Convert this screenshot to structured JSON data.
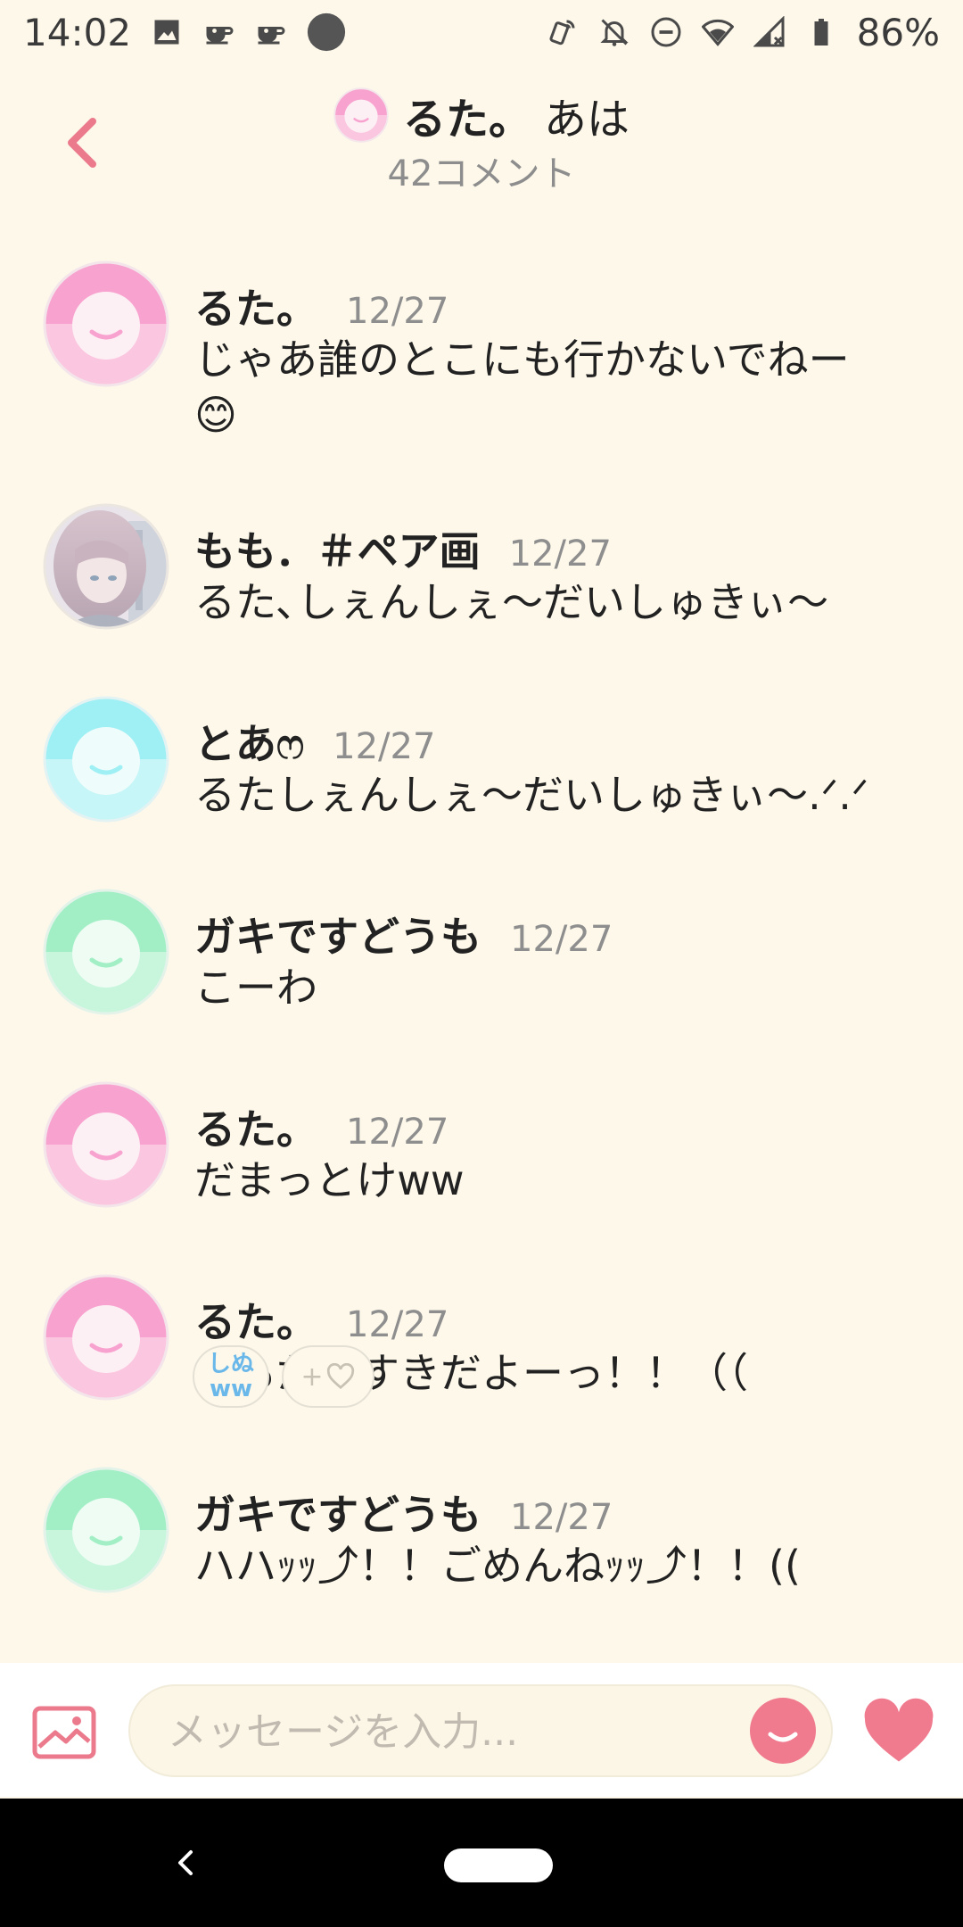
{
  "status_bar": {
    "time": "14:02",
    "battery": "86%"
  },
  "header": {
    "title_name": "るた。",
    "title_rest": "あは",
    "comment_count": "42コメント"
  },
  "comments": [
    {
      "name": "るた。",
      "date": "12/27",
      "lines": [
        "じゃあ誰のとこにも行かないでねー",
        "😊"
      ],
      "avatar_color": "#f8a3cf"
    },
    {
      "name": "もも．＃ペア画",
      "date": "12/27",
      "lines": [
        "るた､しぇんしぇ〜だいしゅきぃ〜"
      ],
      "avatar_color": "photo"
    },
    {
      "name": "とあෆ",
      "date": "12/27",
      "lines": [
        "るたしぇんしぇ〜だいしゅきぃ〜.ᐟ.ᐟ"
      ],
      "avatar_color": "#9ff0f4"
    },
    {
      "name": "ガキですどうも",
      "date": "12/27",
      "lines": [
        "こーわ"
      ],
      "avatar_color": "#a3efc5"
    },
    {
      "name": "るた。",
      "date": "12/27",
      "lines": [
        "だまっとけww"
      ],
      "avatar_color": "#f8a3cf"
    },
    {
      "name": "るた。",
      "date": "12/27",
      "lines": [
        "俺もだいすきだよーっ！！（（"
      ],
      "avatar_color": "#f8a3cf"
    },
    {
      "name": "ガキですどうも",
      "date": "12/27",
      "lines": [
        "ハハｯｯ⤴︎！！ごめんねｯｯ⤴︎！！(("
      ],
      "avatar_color": "#a3efc5"
    }
  ],
  "reactions": {
    "reaction_1": "しぬ\nww",
    "add_label": "+"
  },
  "input": {
    "placeholder": "メッセージを入力..."
  },
  "colors": {
    "accent": "#f07a8e",
    "background": "#fdf8ea",
    "pink_avatar": "#f8a3cf",
    "cyan_avatar": "#9ff0f4",
    "green_avatar": "#a3efc5"
  }
}
